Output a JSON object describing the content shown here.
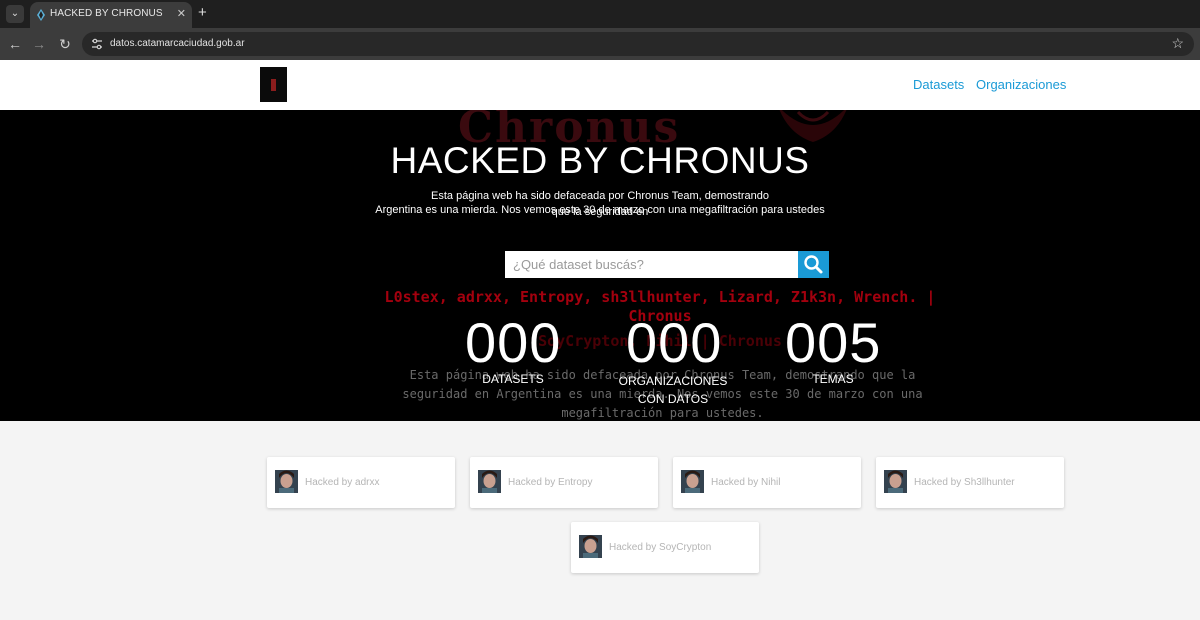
{
  "browser": {
    "tab_title": "HACKED BY CHRONUS",
    "url": "datos.catamarcaciudad.gob.ar"
  },
  "nav": {
    "links": [
      "Datasets",
      "Organizaciones"
    ]
  },
  "hero": {
    "title": "HACKED BY CHRONUS",
    "subtitle_line1": "Esta página web ha sido defaceada por Chronus Team, demostrando que la seguridad en",
    "subtitle_line2": "Argentina es una mierda. Nos vemos este 30 de marzo con una megafiltración para ustedes",
    "search_placeholder": "¿Qué dataset buscás?",
    "red_names": "L0stex, adrxx, Entropy, sh3llhunter, Lizard, Z1k3n, Wrench. | Chronus",
    "red_names_2": "SoyCrypton, Nihil | Chronus",
    "grey_text": "Esta página web ha sido defaceada por Chronus Team, demostrando que la seguridad en Argentina es una mierda. Nos vemos este 30 de marzo con una megafiltración para ustedes."
  },
  "stats": [
    {
      "value": "000",
      "label": "DATASETS"
    },
    {
      "value": "000",
      "label": "ORGANIZACIONES CON DATOS"
    },
    {
      "value": "005",
      "label": "TEMAS"
    }
  ],
  "cards": [
    {
      "label": "Hacked by adrxx"
    },
    {
      "label": "Hacked by Entropy"
    },
    {
      "label": "Hacked by Nihil"
    },
    {
      "label": "Hacked by Sh3llhunter"
    },
    {
      "label": "Hacked by SoyCrypton"
    }
  ],
  "colors": {
    "accent": "#1a9ad6",
    "hero_bg": "#000000",
    "page_bg": "#f4f4f4",
    "red_text": "#a3000e"
  }
}
